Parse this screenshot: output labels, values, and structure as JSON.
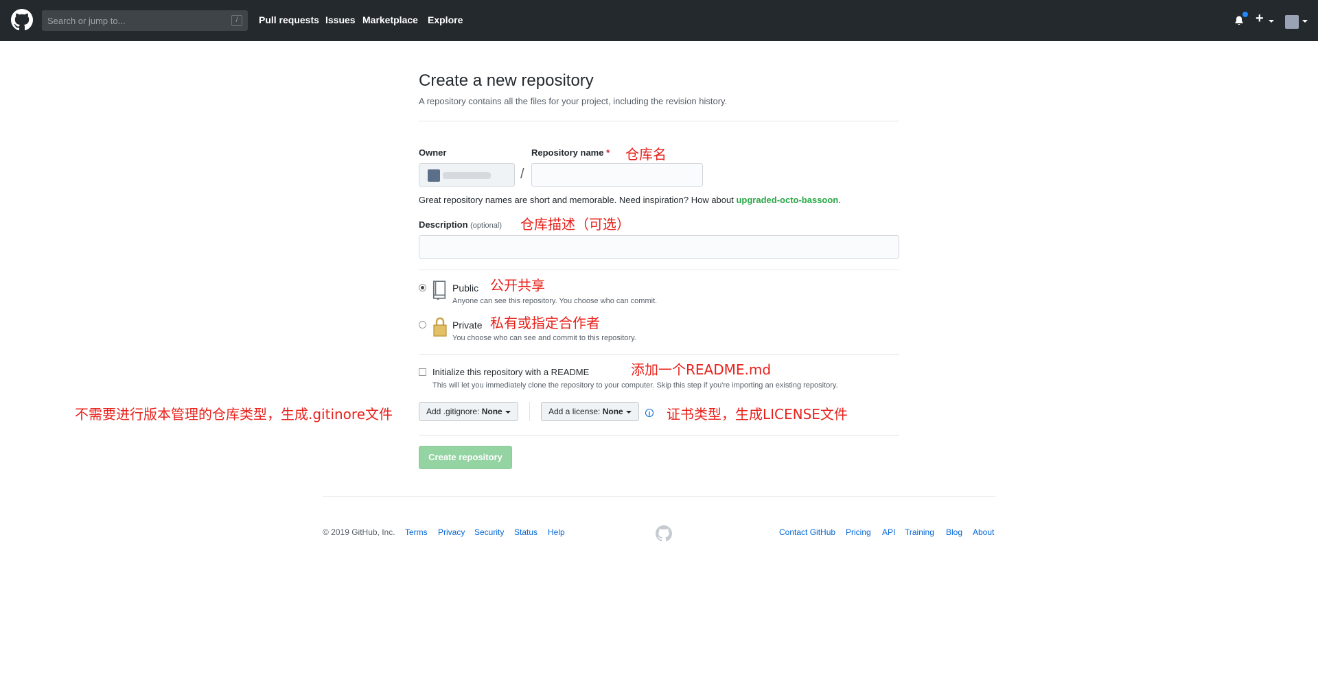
{
  "header": {
    "search_placeholder": "Search or jump to...",
    "search_shortcut": "/",
    "nav": [
      "Pull requests",
      "Issues",
      "Marketplace",
      "Explore"
    ],
    "plus_label": "+"
  },
  "page": {
    "title": "Create a new repository",
    "subtitle": "A repository contains all the files for your project, including the revision history.",
    "owner_label": "Owner",
    "repo_label": "Repository name",
    "required_mark": "*",
    "separator": "/",
    "name_hint_prefix": "Great repository names are short and memorable. Need inspiration? How about ",
    "name_hint_suggestion": "upgraded-octo-bassoon",
    "name_hint_suffix": ".",
    "description_label": "Description",
    "description_optional": "(optional)",
    "public_label": "Public",
    "public_desc": "Anyone can see this repository. You choose who can commit.",
    "private_label": "Private",
    "private_desc": "You choose who can see and commit to this repository.",
    "readme_label": "Initialize this repository with a README",
    "readme_desc": "This will let you immediately clone the repository to your computer. Skip this step if you're importing an existing repository.",
    "gitignore_prefix": "Add .gitignore:",
    "gitignore_value": "None",
    "license_prefix": "Add a license:",
    "license_value": "None",
    "info_glyph": "i",
    "create_button": "Create repository"
  },
  "annotations": {
    "repo_name": "仓库名",
    "description": "仓库描述（可选）",
    "public": "公开共享",
    "private": "私有或指定合作者",
    "readme": "添加一个README.md",
    "gitignore": "不需要进行版本管理的仓库类型，生成.gitinore文件",
    "license": "证书类型，生成LICENSE文件"
  },
  "footer": {
    "copyright": "© 2019 GitHub, Inc.",
    "left_links": [
      "Terms",
      "Privacy",
      "Security",
      "Status",
      "Help"
    ],
    "right_links": [
      "Contact GitHub",
      "Pricing",
      "API",
      "Training",
      "Blog",
      "About"
    ]
  },
  "colors": {
    "header_bg": "#24292e",
    "annotation": "#e8211b",
    "create_button": "#94d3a2",
    "link": "#0366d6"
  }
}
